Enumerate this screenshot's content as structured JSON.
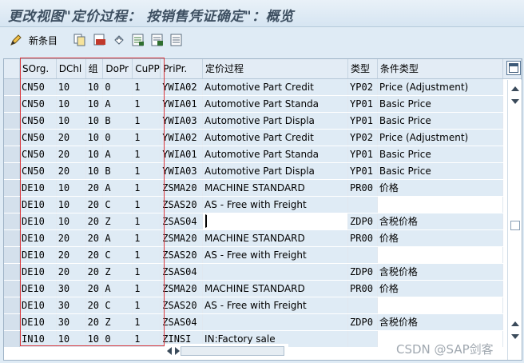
{
  "title": "更改视图\"定价过程： 按销售凭证确定\"：概览",
  "toolbar": {
    "new_entries_label": "新条目"
  },
  "table": {
    "headers": [
      "SOrg.",
      "DChl",
      "组",
      "DoPr",
      "CuPP",
      "PriPr.",
      "定价过程",
      "类型",
      "条件类型"
    ],
    "rows": [
      [
        "CN50",
        "10",
        "10",
        "0",
        "1",
        "YWIA02",
        "Automotive Part Credit",
        "YP02",
        "Price (Adjustment)"
      ],
      [
        "CN50",
        "10",
        "10",
        "A",
        "1",
        "YWIA01",
        "Automotive Part Standa",
        "YP01",
        "Basic Price"
      ],
      [
        "CN50",
        "10",
        "10",
        "B",
        "1",
        "YWIA03",
        "Automotive Part Displa",
        "YP01",
        "Basic Price"
      ],
      [
        "CN50",
        "20",
        "10",
        "0",
        "1",
        "YWIA02",
        "Automotive Part Credit",
        "YP02",
        "Price (Adjustment)"
      ],
      [
        "CN50",
        "20",
        "10",
        "A",
        "1",
        "YWIA01",
        "Automotive Part Standa",
        "YP01",
        "Basic Price"
      ],
      [
        "CN50",
        "20",
        "10",
        "B",
        "1",
        "YWIA03",
        "Automotive Part Displa",
        "YP01",
        "Basic Price"
      ],
      [
        "DE10",
        "10",
        "20",
        "A",
        "1",
        "ZSMA20",
        "MACHINE STANDARD",
        "PR00",
        "价格"
      ],
      [
        "DE10",
        "10",
        "20",
        "C",
        "1",
        "ZSAS20",
        "AS - Free with Freight",
        "",
        ""
      ],
      [
        "DE10",
        "10",
        "20",
        "Z",
        "1",
        "ZSAS04",
        "",
        "ZDP0",
        "含税价格"
      ],
      [
        "DE10",
        "20",
        "20",
        "A",
        "1",
        "ZSMA20",
        "MACHINE STANDARD",
        "PR00",
        "价格"
      ],
      [
        "DE10",
        "20",
        "20",
        "C",
        "1",
        "ZSAS20",
        "AS - Free with Freight",
        "",
        ""
      ],
      [
        "DE10",
        "20",
        "20",
        "Z",
        "1",
        "ZSAS04",
        "",
        "ZDP0",
        "含税价格"
      ],
      [
        "DE10",
        "30",
        "20",
        "A",
        "1",
        "ZSMA20",
        "MACHINE STANDARD",
        "PR00",
        "价格"
      ],
      [
        "DE10",
        "30",
        "20",
        "C",
        "1",
        "ZSAS20",
        "AS - Free with Freight",
        "",
        ""
      ],
      [
        "DE10",
        "30",
        "20",
        "Z",
        "1",
        "ZSAS04",
        "",
        "ZDP0",
        "含税价格"
      ],
      [
        "IN10",
        "10",
        "10",
        "0",
        "1",
        "ZINSI",
        "IN:Factory sale",
        "",
        ""
      ]
    ]
  },
  "watermark": "CSDN @SAP剑客",
  "colors": {
    "title_text": "#3d4f61",
    "grid_bg": "#dfebf5",
    "highlight_box": "#d9363b"
  }
}
